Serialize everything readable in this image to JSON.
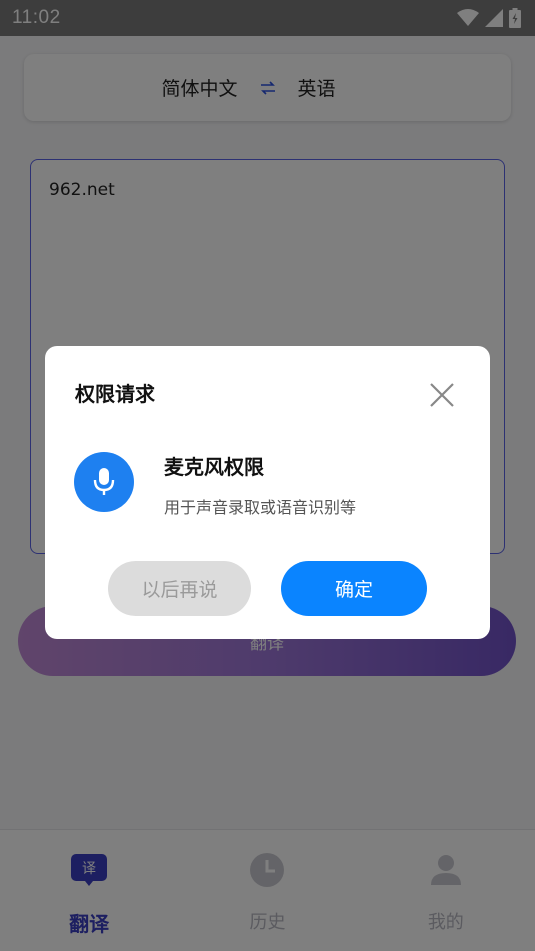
{
  "status_bar": {
    "time": "11:02"
  },
  "language_bar": {
    "source": "简体中文",
    "target": "英语"
  },
  "input": {
    "text": "962.net"
  },
  "translate_button": {
    "label": "翻译"
  },
  "tabs": [
    {
      "label": "翻译",
      "icon_text": "译",
      "icon": "translate-icon"
    },
    {
      "label": "历史",
      "icon": "clock-icon"
    },
    {
      "label": "我的",
      "icon": "person-icon"
    }
  ],
  "dialog": {
    "title": "权限请求",
    "permission_name": "麦克风权限",
    "permission_desc": "用于声音录取或语音识别等",
    "later_label": "以后再说",
    "ok_label": "确定"
  },
  "colors": {
    "accent": "#3a3fc2",
    "primary_button": "#0a84ff",
    "mic_badge": "#1e80f0"
  }
}
